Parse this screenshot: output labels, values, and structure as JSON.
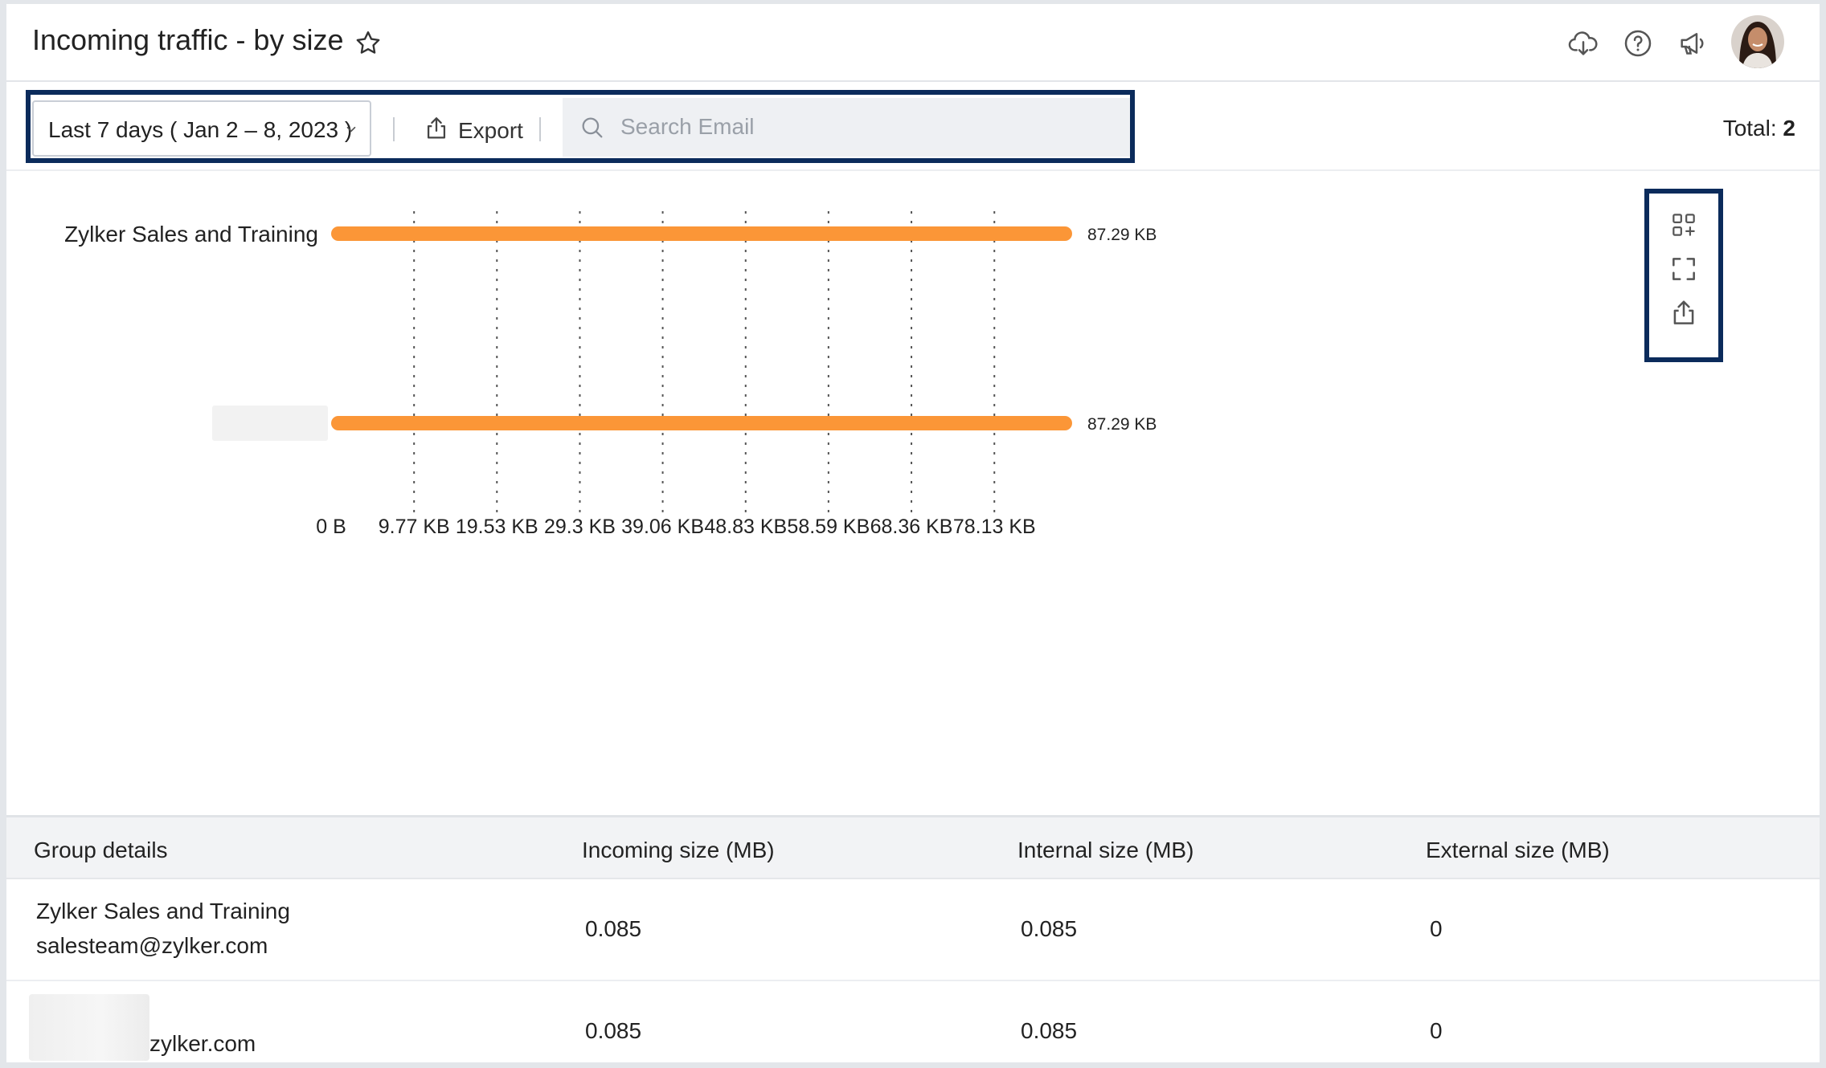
{
  "header": {
    "title": "Incoming traffic - by size",
    "icons": [
      "star-icon",
      "cloud-download-icon",
      "help-icon",
      "announcement-icon",
      "avatar"
    ]
  },
  "toolbar": {
    "date_range": "Last 7 days ( Jan 2 – 8, 2023 )",
    "export_label": "Export",
    "search_placeholder": "Search Email",
    "total_label": "Total:",
    "total_value": "2"
  },
  "colors": {
    "bar": "#fb9637",
    "highlight_border": "#0b2b5b",
    "grid": "#555555"
  },
  "chart_data": {
    "type": "bar",
    "orientation": "horizontal",
    "categories": [
      "Zylker Sales and Training",
      ""
    ],
    "values": [
      87.29,
      87.29
    ],
    "value_labels": [
      "87.29 KB",
      "87.29 KB"
    ],
    "x_ticks": [
      "0 B",
      "9.77 KB",
      "19.53 KB",
      "29.3 KB",
      "39.06 KB",
      "48.83 KB",
      "58.59 KB",
      "68.36 KB",
      "78.13 KB"
    ],
    "x_tick_values": [
      0,
      9.77,
      19.53,
      29.3,
      39.06,
      48.83,
      58.59,
      68.36,
      78.13
    ],
    "xlim": [
      0,
      87.29
    ],
    "grid": "vertical dotted",
    "legend": "none",
    "tools": [
      "widgets-icon",
      "fullscreen-icon",
      "share-icon"
    ]
  },
  "table": {
    "columns": [
      "Group details",
      "Incoming size (MB)",
      "Internal size (MB)",
      "External size (MB)"
    ],
    "rows": [
      {
        "name": "Zylker Sales and Training",
        "email": "salesteam@zylker.com",
        "incoming": "0.085",
        "internal": "0.085",
        "external": "0"
      },
      {
        "name": "",
        "email": "zylker.com",
        "incoming": "0.085",
        "internal": "0.085",
        "external": "0"
      }
    ]
  }
}
